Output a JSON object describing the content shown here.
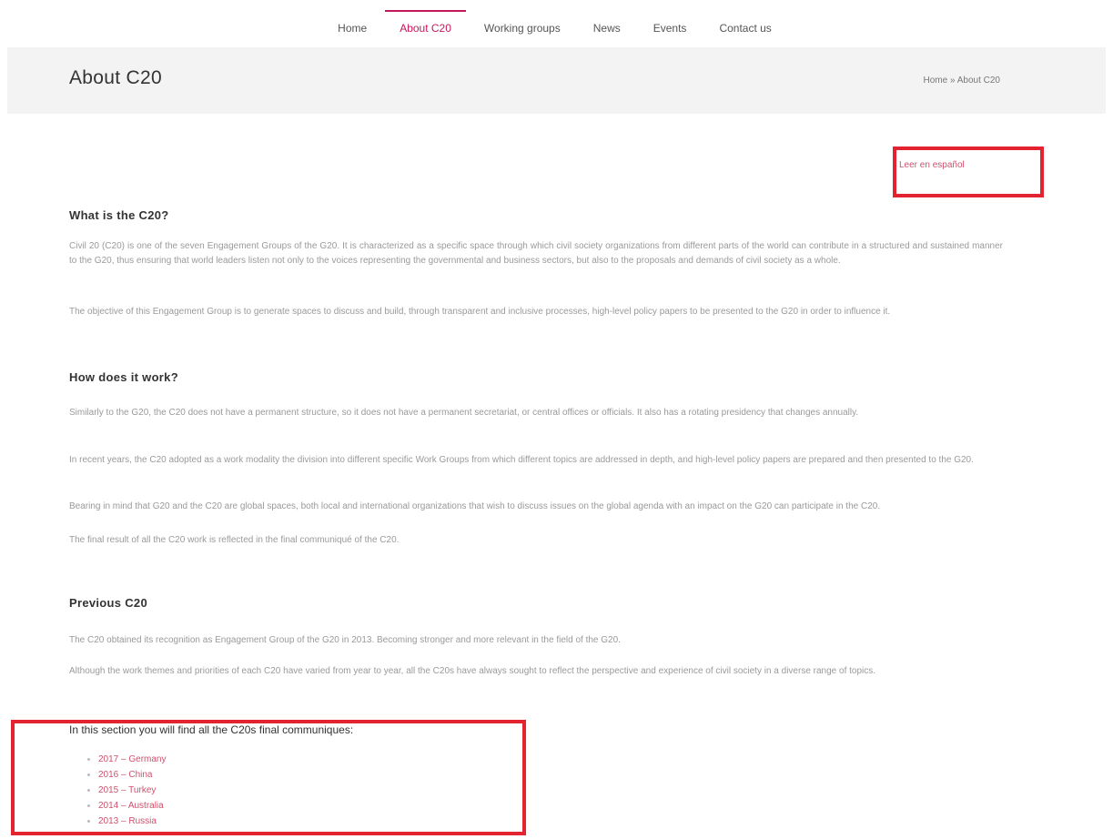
{
  "nav": {
    "items": [
      "Home",
      "About C20",
      "Working groups",
      "News",
      "Events",
      "Contact us"
    ],
    "active": 1
  },
  "header": {
    "title": "About C20",
    "breadcrumb": "Home » About C20"
  },
  "spanish_link": "Leer en español",
  "sections": {
    "what": {
      "heading": "What is the C20?",
      "p1": "Civil 20 (C20) is one of the seven Engagement Groups of the G20. It is characterized as a specific space through which civil society organizations from different parts of the world can contribute in a structured and sustained manner to the G20, thus ensuring that world leaders listen not only to the voices representing the governmental and business sectors, but also to the proposals and demands of civil society as a whole.",
      "p2": "The objective of this Engagement Group is to generate spaces to discuss and build, through transparent and inclusive processes, high-level policy papers to be presented to the G20 in order to influence it."
    },
    "how": {
      "heading": "How does it work?",
      "p1": "Similarly to the G20, the C20 does not have a permanent structure, so it does not  have a permanent secretariat, or central offices or officials. It also has a rotating presidency that changes annually.",
      "p2": "In recent years, the C20 adopted as a work modality the division into different specific Work Groups from which different topics are addressed in depth, and high-level policy papers are prepared and then presented to the G20.",
      "p3": "Bearing in mind that G20 and the C20 are global spaces, both local and international organizations that wish to discuss issues on the global agenda with an impact on the G20 can  participate in the C20.",
      "p4": "The final result of all the C20 work  is reflected in the final communiqué of the C20."
    },
    "previous": {
      "heading": "Previous C20",
      "p1": "The C20 obtained its recognition as Engagement Group of the G20 in 2013. Becoming stronger and more relevant in the field of the G20.",
      "p2": "Although the work themes and priorities of each C20 have varied from year to year, all the C20s have always sought to reflect the perspective and experience of civil society in a diverse range of topics.",
      "list_heading": "In this section you will find all the C20s final communiques:",
      "communiques": [
        "2017 – Germany",
        "2016 – China",
        "2015 – Turkey",
        "2014 – Australia",
        "2013 – Russia"
      ]
    }
  },
  "colors": {
    "accent": "#c2185b",
    "link": "#d0506c",
    "highlight_box": "#e3232f",
    "band": "#f3f3f3"
  }
}
